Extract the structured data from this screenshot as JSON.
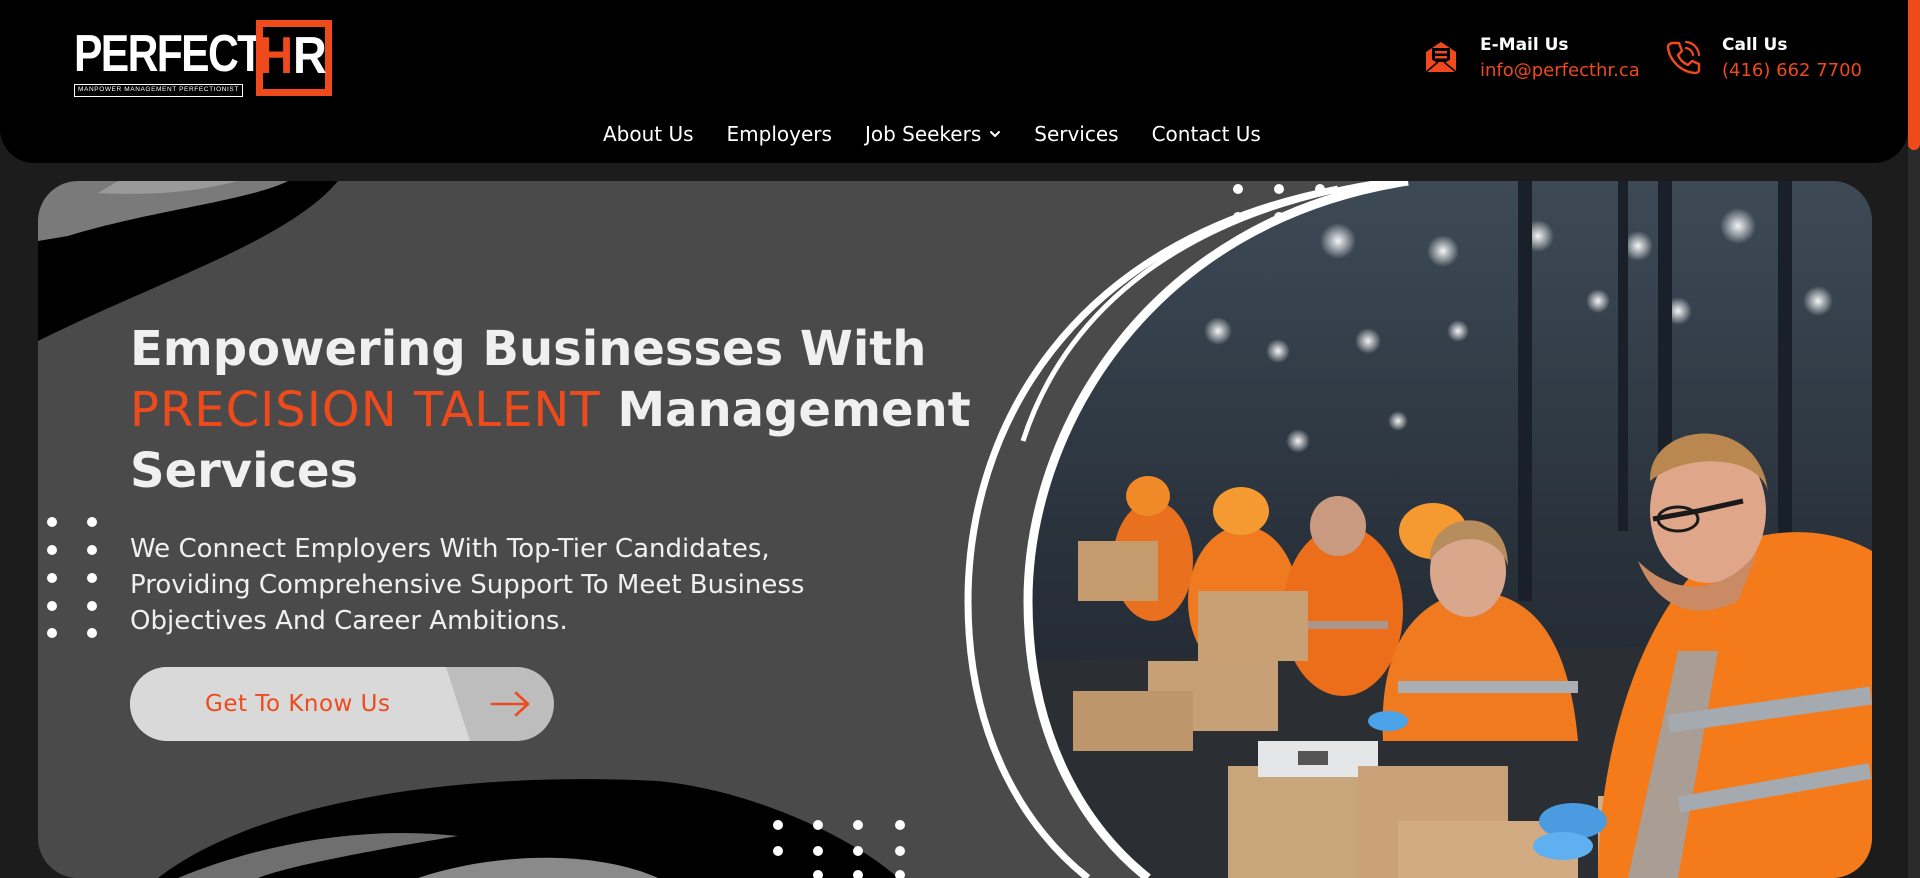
{
  "brand": {
    "logo_word": "PERFECT",
    "logo_mark_h": "H",
    "logo_mark_r": "R",
    "tagline": "MANPOWER MANAGEMENT PERFECTIONIST",
    "accent_color": "#ee4a1b"
  },
  "header": {
    "email": {
      "label": "E-Mail Us",
      "value": "info@perfecthr.ca",
      "icon": "envelope-icon"
    },
    "call": {
      "label": "Call Us",
      "value": "(416) 662 7700",
      "icon": "phone-icon"
    },
    "nav": [
      {
        "label": "About Us"
      },
      {
        "label": "Employers"
      },
      {
        "label": "Job Seekers",
        "has_dropdown": true
      },
      {
        "label": "Services"
      },
      {
        "label": "Contact Us"
      }
    ]
  },
  "hero": {
    "title_line1": "Empowering Businesses With",
    "title_accent": "PRECISION TALENT",
    "title_line2_rest": "Management",
    "title_line3": "Services",
    "subtitle_line1": "We Connect Employers With Top-Tier Candidates,",
    "subtitle_line2": "Providing Comprehensive Support To Meet Business",
    "subtitle_line3": "Objectives And Career Ambitions.",
    "cta_label": "Get To Know Us",
    "photo": "warehouse-workers-packing-boxes"
  }
}
